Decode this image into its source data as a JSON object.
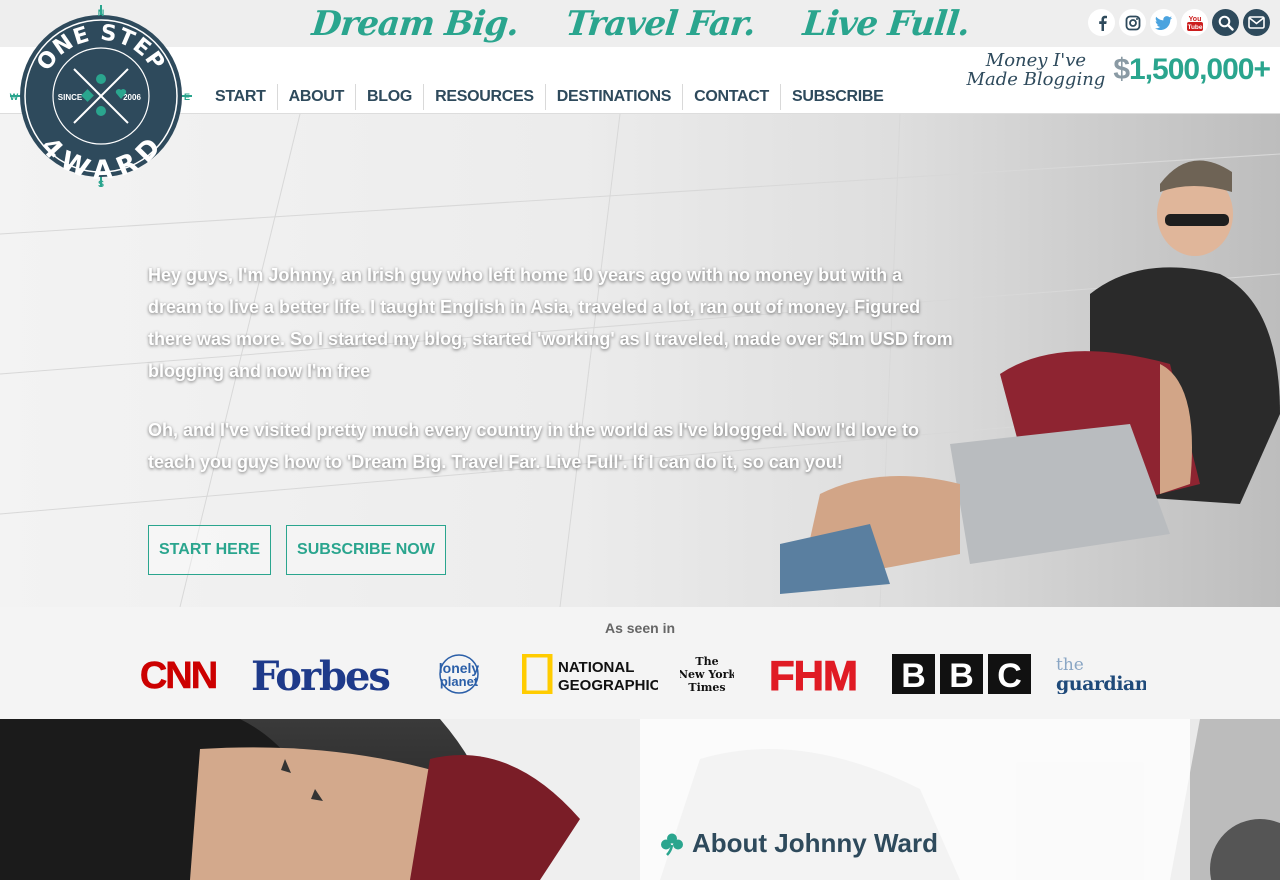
{
  "header": {
    "tagline": [
      "Dream Big.",
      "Travel Far.",
      "Live Full."
    ],
    "social_icons": [
      "facebook-icon",
      "instagram-icon",
      "twitter-icon",
      "youtube-icon",
      "search-icon",
      "mail-icon"
    ],
    "logo": {
      "text_top": "ONE STEP",
      "text_bottom": "4WARD",
      "since_label": "SINCE",
      "year": "2006",
      "compass": [
        "N",
        "S",
        "E",
        "W"
      ]
    },
    "nav": [
      "START",
      "ABOUT",
      "BLOG",
      "RESOURCES",
      "DESTINATIONS",
      "CONTACT",
      "SUBSCRIBE"
    ],
    "money_label_line1": "Money I've",
    "money_label_line2": "Made Blogging",
    "money_currency": "$",
    "money_amount": "1,500,000+"
  },
  "hero": {
    "paragraph1": "Hey guys, I'm Johnny, an Irish guy who left home 10 years ago with no money but with a dream to live a better life. I taught English in Asia, traveled a lot, ran out of money. Figured there was more. So I started my blog, started 'working' as I traveled, made over $1m USD from blogging and now I'm free",
    "paragraph2": "Oh, and I've visited pretty much every country in the world as I've blogged. Now I'd love to teach you guys how to 'Dream Big. Travel Far. Live Full'. If I can do it, so can you!",
    "buttons": [
      "START HERE",
      "SUBSCRIBE NOW"
    ]
  },
  "seen_in": {
    "title": "As seen in",
    "brands": {
      "cnn": "CNN",
      "forbes": "Forbes",
      "lonely1": "lonely",
      "lonely2": "planet",
      "natgeo1": "NATIONAL",
      "natgeo2": "GEOGRAPHIC",
      "nyt1": "The",
      "nyt2": "New York",
      "nyt3": "Times",
      "fhm": "FHM",
      "bbc": [
        "B",
        "B",
        "C"
      ],
      "guardian1": "the",
      "guardian2": "guardian"
    }
  },
  "about": {
    "title": "About Johnny Ward"
  },
  "colors": {
    "teal": "#2aa58e",
    "navy": "#2e4a5c",
    "cnn_red": "#cc0000",
    "forbes_blue": "#1e3a8a",
    "natgeo_yellow": "#ffcc00"
  }
}
